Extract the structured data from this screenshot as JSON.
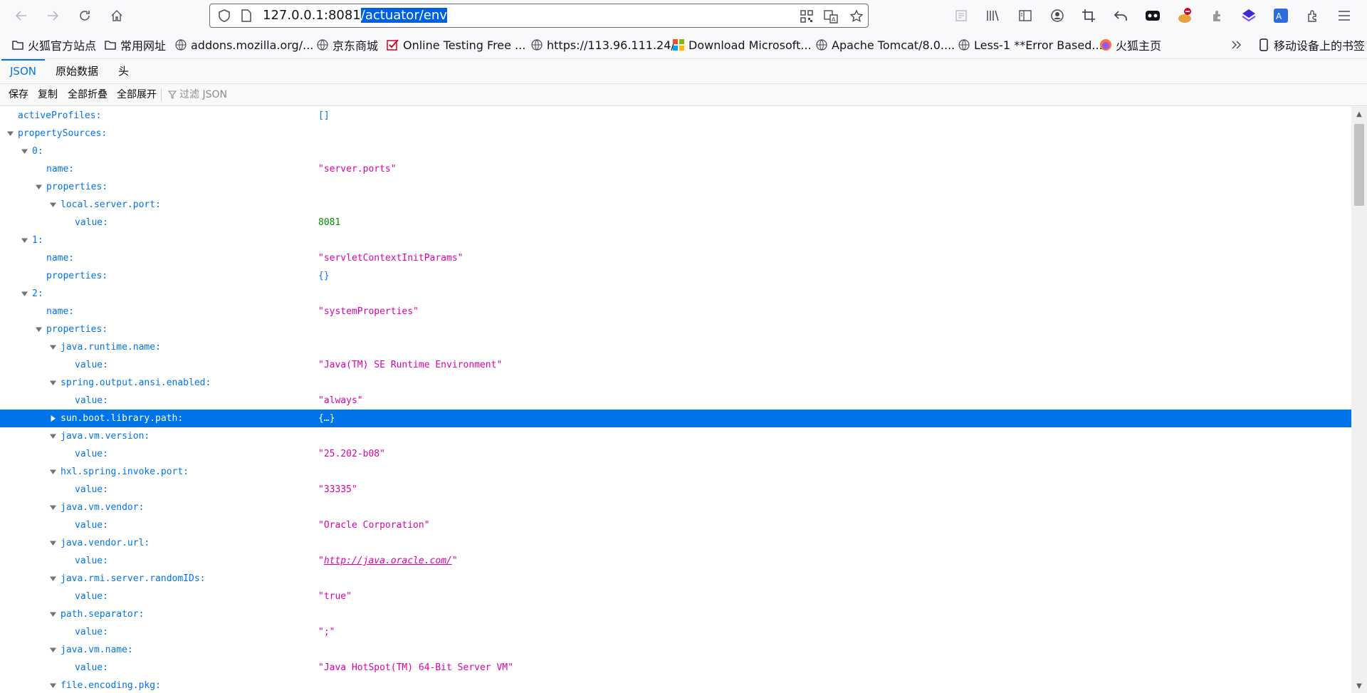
{
  "browser": {
    "url_plain": "127.0.0.1:8081",
    "url_selected": "/actuator/env"
  },
  "bookmarks": [
    {
      "label": "火狐官方站点",
      "icon": "folder-icon"
    },
    {
      "label": "常用网址",
      "icon": "folder-icon"
    },
    {
      "label": "addons.mozilla.org/...",
      "icon": "globe-icon"
    },
    {
      "label": "京东商城",
      "icon": "globe-icon"
    },
    {
      "label": "Online Testing Free ...",
      "icon": "checkbox-icon"
    },
    {
      "label": "https://113.96.111.24/",
      "icon": "globe-icon"
    },
    {
      "label": "Download Microsoft...",
      "icon": "microsoft-icon"
    },
    {
      "label": "Apache Tomcat/8.0....",
      "icon": "globe-icon"
    },
    {
      "label": "Less-1 **Error Based...",
      "icon": "globe-icon"
    },
    {
      "label": "火狐主页",
      "icon": "firefox-icon"
    }
  ],
  "mobile_bookmarks": "移动设备上的书签",
  "json_viewer": {
    "tabs": [
      "JSON",
      "原始数据",
      "头"
    ],
    "toolbar": {
      "save": "保存",
      "copy": "复制",
      "collapse_all": "全部折叠",
      "expand_all": "全部展开",
      "filter_placeholder": "过滤 JSON"
    }
  },
  "tree": [
    {
      "key": "activeProfiles:",
      "value": "[]",
      "type": "obj",
      "level": 0,
      "toggle": "none"
    },
    {
      "key": "propertySources:",
      "value": "",
      "type": "",
      "level": 0,
      "toggle": "open"
    },
    {
      "key": "0:",
      "value": "",
      "type": "",
      "level": 1,
      "toggle": "open"
    },
    {
      "key": "name:",
      "value": "\"server.ports\"",
      "type": "str",
      "level": 2,
      "toggle": "none"
    },
    {
      "key": "properties:",
      "value": "",
      "type": "",
      "level": 2,
      "toggle": "open"
    },
    {
      "key": "local.server.port:",
      "value": "",
      "type": "",
      "level": 3,
      "toggle": "open"
    },
    {
      "key": "value:",
      "value": "8081",
      "type": "num",
      "level": 4,
      "toggle": "none"
    },
    {
      "key": "1:",
      "value": "",
      "type": "",
      "level": 1,
      "toggle": "open"
    },
    {
      "key": "name:",
      "value": "\"servletContextInitParams\"",
      "type": "str",
      "level": 2,
      "toggle": "none"
    },
    {
      "key": "properties:",
      "value": "{}",
      "type": "obj",
      "level": 2,
      "toggle": "none"
    },
    {
      "key": "2:",
      "value": "",
      "type": "",
      "level": 1,
      "toggle": "open"
    },
    {
      "key": "name:",
      "value": "\"systemProperties\"",
      "type": "str",
      "level": 2,
      "toggle": "none"
    },
    {
      "key": "properties:",
      "value": "",
      "type": "",
      "level": 2,
      "toggle": "open"
    },
    {
      "key": "java.runtime.name:",
      "value": "",
      "type": "",
      "level": 3,
      "toggle": "open"
    },
    {
      "key": "value:",
      "value": "\"Java(TM) SE Runtime Environment\"",
      "type": "str",
      "level": 4,
      "toggle": "none"
    },
    {
      "key": "spring.output.ansi.enabled:",
      "value": "",
      "type": "",
      "level": 3,
      "toggle": "open"
    },
    {
      "key": "value:",
      "value": "\"always\"",
      "type": "str",
      "level": 4,
      "toggle": "none"
    },
    {
      "key": "sun.boot.library.path:",
      "value": "{…}",
      "type": "obj",
      "level": 3,
      "toggle": "closed",
      "selected": true
    },
    {
      "key": "java.vm.version:",
      "value": "",
      "type": "",
      "level": 3,
      "toggle": "open"
    },
    {
      "key": "value:",
      "value": "\"25.202-b08\"",
      "type": "str",
      "level": 4,
      "toggle": "none"
    },
    {
      "key": "hxl.spring.invoke.port:",
      "value": "",
      "type": "",
      "level": 3,
      "toggle": "open"
    },
    {
      "key": "value:",
      "value": "\"33335\"",
      "type": "str",
      "level": 4,
      "toggle": "none"
    },
    {
      "key": "java.vm.vendor:",
      "value": "",
      "type": "",
      "level": 3,
      "toggle": "open"
    },
    {
      "key": "value:",
      "value": "\"Oracle Corporation\"",
      "type": "str",
      "level": 4,
      "toggle": "none"
    },
    {
      "key": "java.vendor.url:",
      "value": "",
      "type": "",
      "level": 3,
      "toggle": "open"
    },
    {
      "key": "value:",
      "value": "http://java.oracle.com/",
      "type": "link",
      "level": 4,
      "toggle": "none"
    },
    {
      "key": "java.rmi.server.randomIDs:",
      "value": "",
      "type": "",
      "level": 3,
      "toggle": "open"
    },
    {
      "key": "value:",
      "value": "\"true\"",
      "type": "str",
      "level": 4,
      "toggle": "none"
    },
    {
      "key": "path.separator:",
      "value": "",
      "type": "",
      "level": 3,
      "toggle": "open"
    },
    {
      "key": "value:",
      "value": "\";\"",
      "type": "str",
      "level": 4,
      "toggle": "none"
    },
    {
      "key": "java.vm.name:",
      "value": "",
      "type": "",
      "level": 3,
      "toggle": "open"
    },
    {
      "key": "value:",
      "value": "\"Java HotSpot(TM) 64-Bit Server VM\"",
      "type": "str",
      "level": 4,
      "toggle": "none"
    },
    {
      "key": "file.encoding.pkg:",
      "value": "",
      "type": "",
      "level": 3,
      "toggle": "open"
    }
  ]
}
